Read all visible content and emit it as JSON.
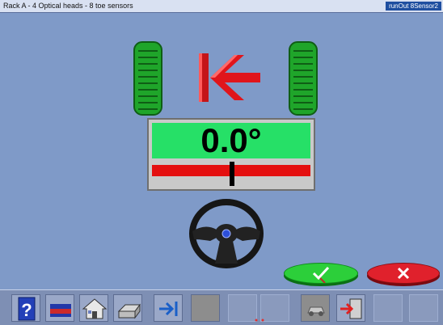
{
  "titlebar": {
    "title": "Rack A - 4 Optical heads - 8 toe sensors",
    "badge": "runOut 8Sensor2"
  },
  "readout": {
    "value": "0.0°"
  },
  "colors": {
    "tire_green": "#1fa52a",
    "readout_green": "#26e067",
    "red": "#e40f0f",
    "ok_green": "#2ccf3a",
    "cancel_red": "#e0212c"
  },
  "toolbar": {
    "items": [
      {
        "icon": "help-icon"
      },
      {
        "icon": "vehicle-lift-icon"
      },
      {
        "icon": "home-icon"
      },
      {
        "icon": "printer-icon"
      },
      {
        "icon": "next-arrow-icon"
      },
      {
        "icon": "disabled-slot"
      },
      {
        "icon": "blank"
      },
      {
        "icon": "blank"
      },
      {
        "icon": "car-icon"
      },
      {
        "icon": "exit-icon"
      },
      {
        "icon": "blank"
      },
      {
        "icon": "blank"
      }
    ]
  }
}
